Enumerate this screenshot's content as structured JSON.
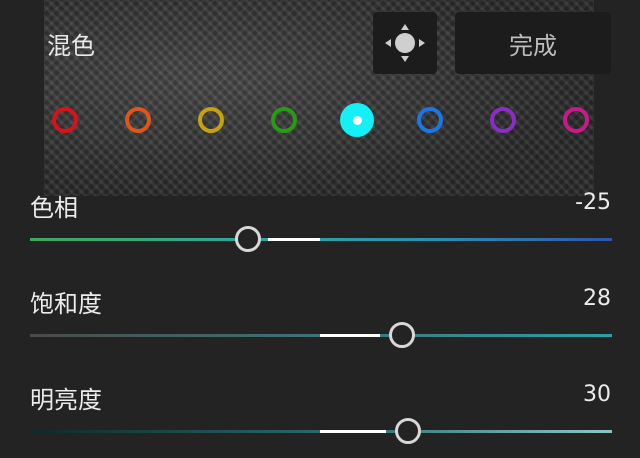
{
  "header": {
    "title": "混色",
    "done_label": "完成"
  },
  "color_swatches": [
    {
      "name": "red",
      "color": "#d8121a",
      "selected": false
    },
    {
      "name": "orange",
      "color": "#e0561a",
      "selected": false
    },
    {
      "name": "yellow",
      "color": "#c8a10c",
      "selected": false
    },
    {
      "name": "green",
      "color": "#2a9a14",
      "selected": false
    },
    {
      "name": "aqua",
      "color": "#14f0f6",
      "selected": true
    },
    {
      "name": "blue",
      "color": "#1a78e6",
      "selected": false
    },
    {
      "name": "purple",
      "color": "#8a2cc8",
      "selected": false
    },
    {
      "name": "magenta",
      "color": "#c81a8a",
      "selected": false
    }
  ],
  "sliders": {
    "hue": {
      "label": "色相",
      "value": "-25",
      "min": -100,
      "max": 100
    },
    "saturation": {
      "label": "饱和度",
      "value": "28",
      "min": -100,
      "max": 100
    },
    "luminance": {
      "label": "明亮度",
      "value": "30",
      "min": -100,
      "max": 100
    }
  },
  "icons": {
    "target_adjust": "move-target-icon"
  }
}
